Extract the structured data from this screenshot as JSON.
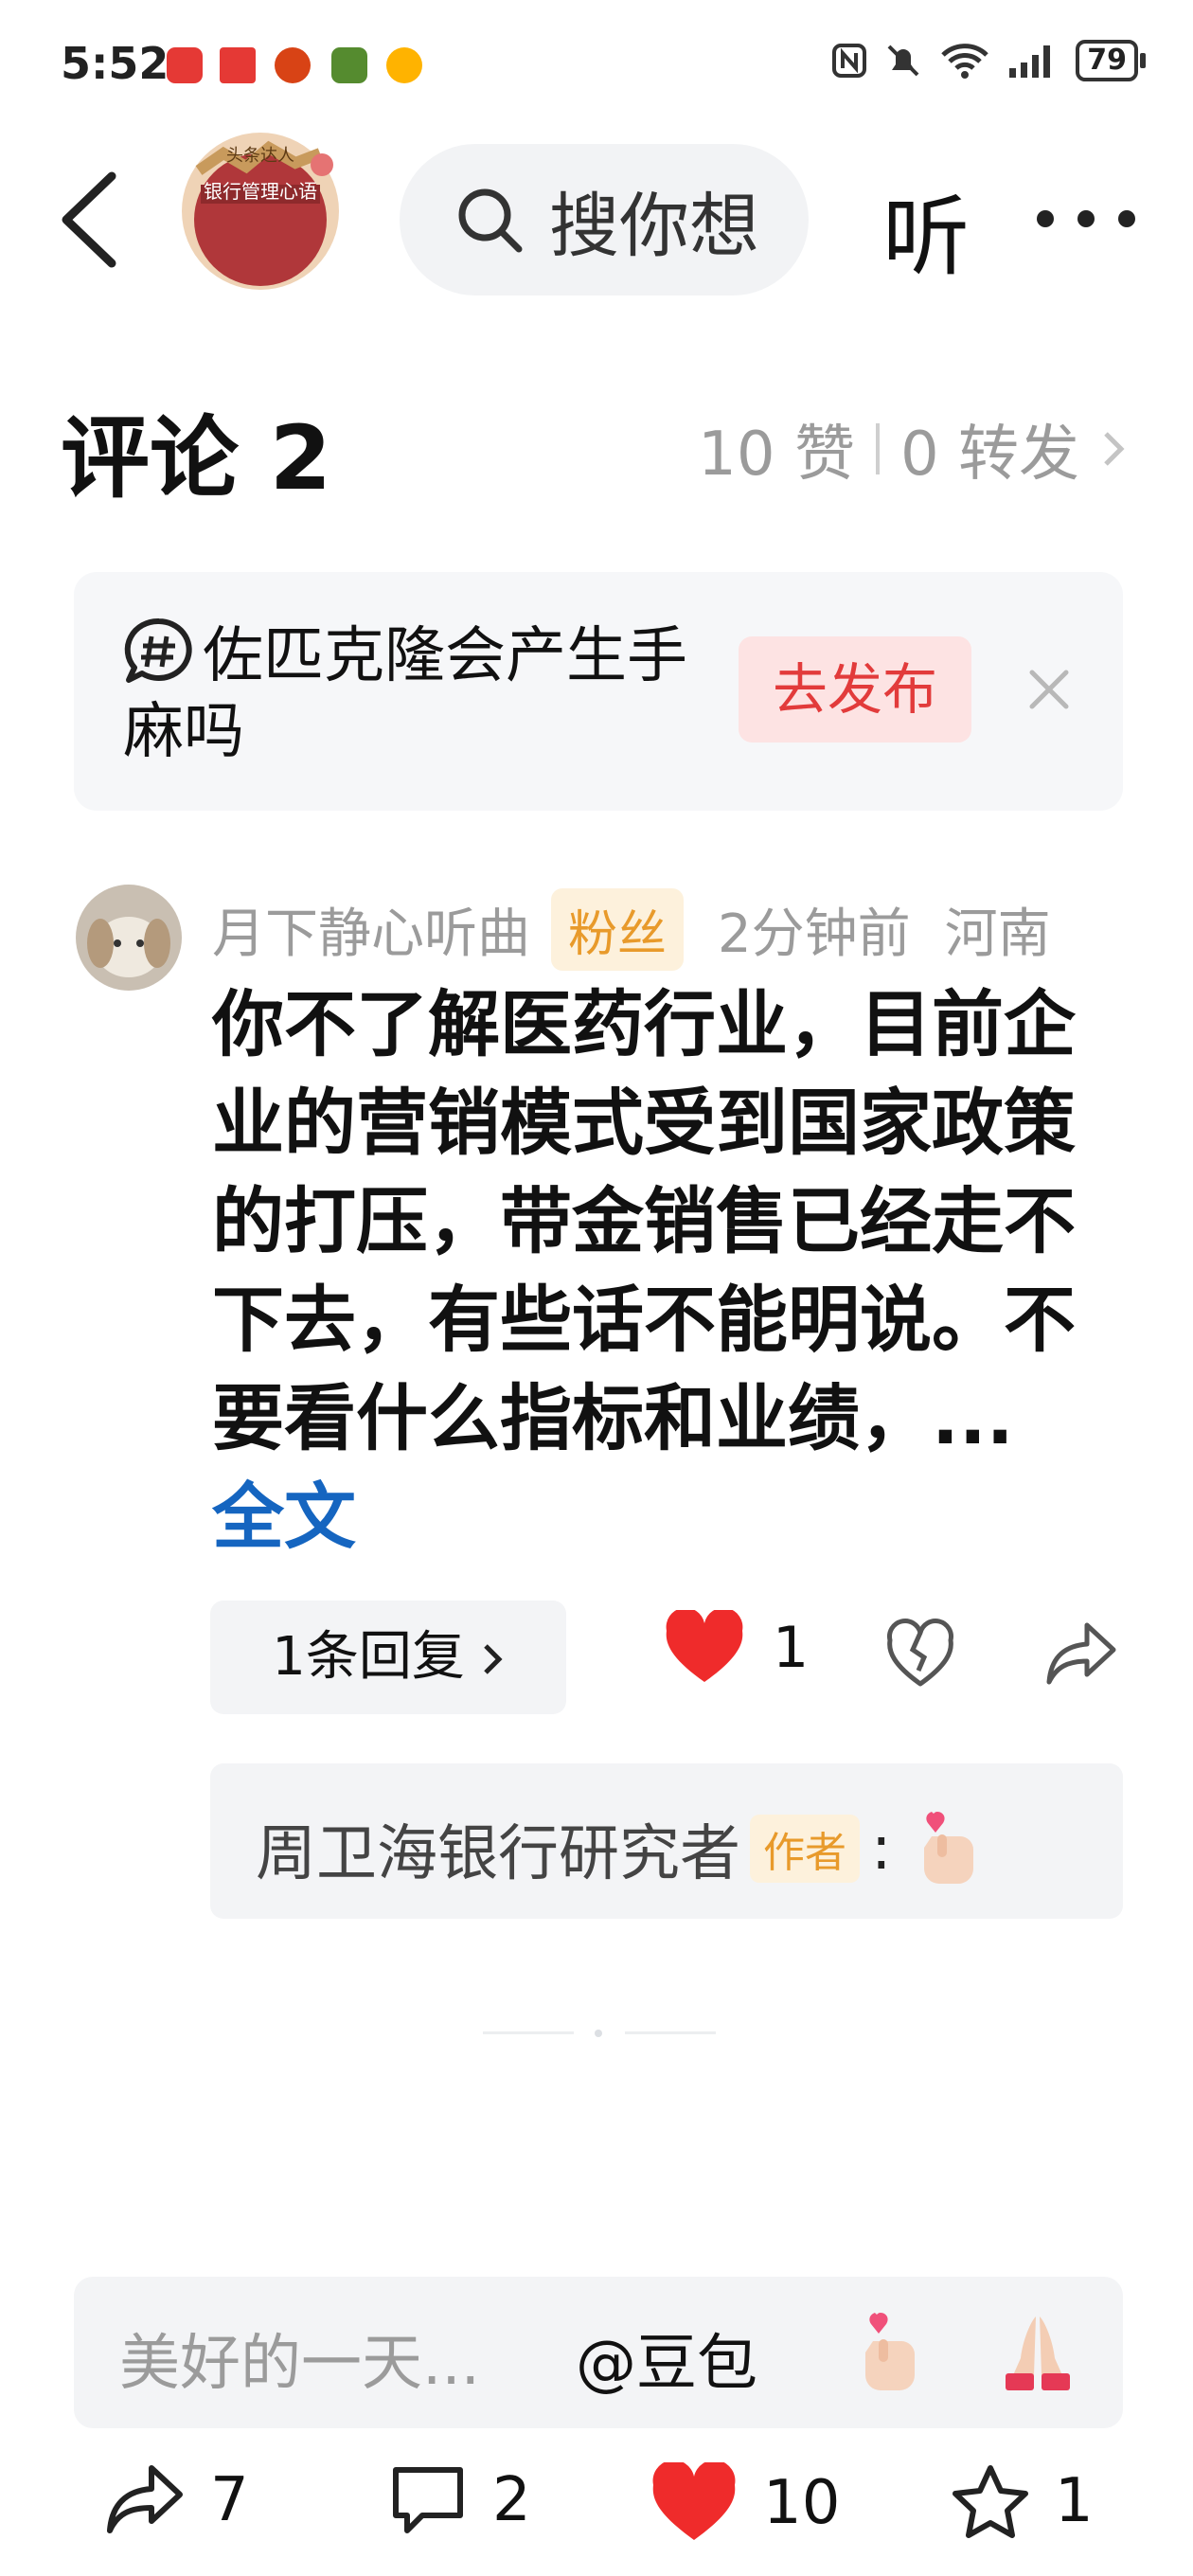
{
  "status_bar": {
    "time": "5:52",
    "battery": "79"
  },
  "header": {
    "avatar_text": "头条达人",
    "avatar_book_title": "银行管理心语",
    "search_placeholder": "搜你想",
    "listen_label": "听"
  },
  "comments_header": {
    "title": "评论 2",
    "likes": "10 赞",
    "reposts": "0 转发"
  },
  "topic_card": {
    "hashtag": "佐匹克隆会产生手麻吗",
    "publish_label": "去发布"
  },
  "comment": {
    "username": "月下静心听曲",
    "badge": "粉丝",
    "time": "2分钟前",
    "location": "河南",
    "text": "你不了解医药行业，目前企业的营销模式受到国家政策的打压，带金销售已经走不下去，有些话不能明说。不要看什么指标和业绩，...",
    "full_text_link": "全文",
    "reply_count_label": "1条回复",
    "like_count": "1"
  },
  "reply": {
    "username": "周卫海银行研究者",
    "badge": "作者",
    "colon": ":"
  },
  "input_bar": {
    "placeholder": "美好的一天...",
    "mention": "@豆包"
  },
  "bottom_bar": {
    "share_count": "7",
    "comment_count": "2",
    "like_count": "10",
    "favorite_count": "1"
  },
  "colors": {
    "like_red": "#ef2b2b",
    "link_blue": "#1565c0",
    "badge_orange": "#e89a2b",
    "publish_red": "#e23b3b"
  }
}
